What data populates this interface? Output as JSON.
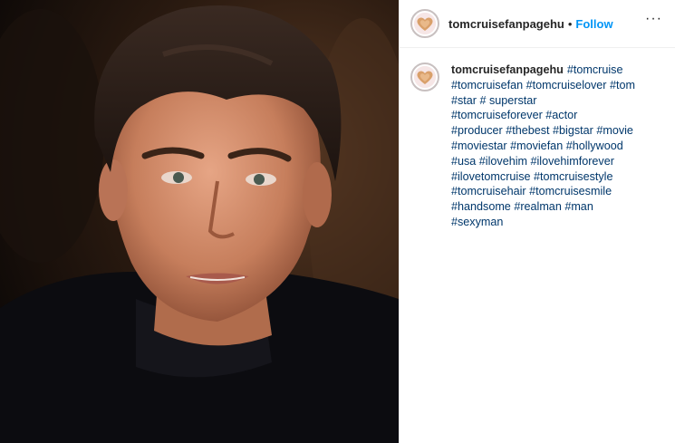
{
  "post": {
    "username": "tomcruisefanpagehu",
    "separator": "•",
    "follow_label": "Follow",
    "more_icon": "more-options-icon",
    "more_label": "···",
    "caption": {
      "username": "tomcruisefanpagehu",
      "lines": [
        "#tomcruise",
        "#tomcruisefan #tomcruiselover #tom",
        "#star # superstar",
        "#tomcruiseforever #actor",
        "#producer #thebest #bigstar #movie",
        "#moviestar #moviefan #hollywood",
        "#usa #ilovehim #ilovehimforever",
        "#ilovetomcruise #tomcruisestyle",
        "#tomcruisehair #tomcruisesmile",
        "#handsome #realman #man",
        "#sexyman"
      ]
    }
  },
  "colors": {
    "link": "#0095f6",
    "hashtag": "#00376b",
    "text": "#262626"
  }
}
